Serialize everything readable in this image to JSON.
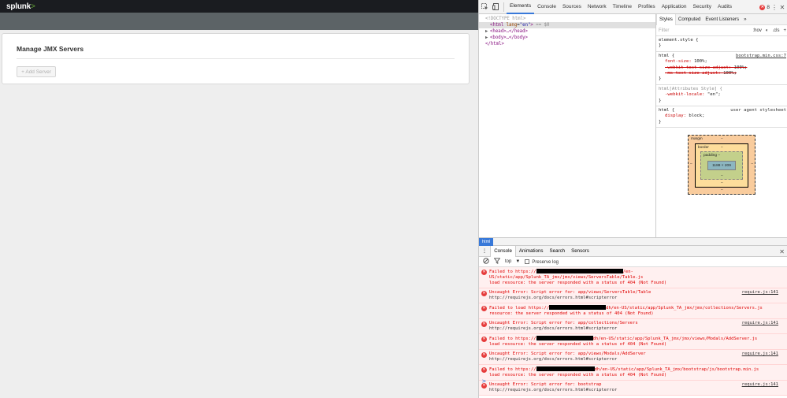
{
  "app": {
    "logo_text": "splunk",
    "logo_suffix": ">",
    "card_title": "Manage JMX Servers",
    "add_server_label": "+ Add Server"
  },
  "devtools": {
    "tabs": [
      "Elements",
      "Console",
      "Sources",
      "Network",
      "Timeline",
      "Profiles",
      "Application",
      "Security",
      "Audits"
    ],
    "active_tab": "Elements",
    "error_count": "8",
    "elements": {
      "doctype": "<!DOCTYPE html>",
      "html_open_tag": "html",
      "html_attr_name": "lang",
      "html_attr_value": "\"en\"",
      "selected_marker": " == $0",
      "head_line": "<head>…</head>",
      "body_line": "<body>…</body>",
      "html_close": "</html>"
    },
    "styles": {
      "tabs": [
        "Styles",
        "Computed",
        "Event Listeners"
      ],
      "filter_placeholder": "Filter",
      "hov_label": ":hov",
      "cls_label": ".cls",
      "element_style": "element.style {",
      "rule1_selector": "html {",
      "rule1_source": "bootstrap.min.css:7",
      "rule1_props": [
        {
          "name": "font-size",
          "value": "100%;",
          "struck": false
        },
        {
          "name": "-webkit-text-size-adjust",
          "value": "100%;",
          "struck": true
        },
        {
          "name": "-ms-text-size-adjust",
          "value": "100%;",
          "struck": true
        }
      ],
      "rule2_selector": "html[Attributes Style] {",
      "rule2_props": [
        {
          "name": "-webkit-locale",
          "value": "\"en\";"
        }
      ],
      "rule3_selector": "html {",
      "rule3_source": "user agent stylesheet",
      "rule3_props": [
        {
          "name": "display",
          "value": "block;"
        }
      ],
      "close_brace": "}"
    },
    "boxmodel": {
      "margin_label": "margin",
      "border_label": "border",
      "padding_label": "padding –",
      "content_size": "1188 × 209",
      "dash": "–"
    },
    "breadcrumb": "html",
    "drawer_tabs": [
      "Console",
      "Animations",
      "Search",
      "Sensors"
    ],
    "console": {
      "context": "top",
      "preserve_log": "Preserve log",
      "messages": [
        {
          "l1a": "Failed to   https://",
          "l1b": "/en-US/static/app/Splunk_TA_jmx/jmx/views/ServersTable/Table.js",
          "l2": "load resource: the server responded with a status of 404 (Not Found)",
          "l3": "",
          "src": ""
        },
        {
          "l1a": "Uncaught Error: Script error for: app/views/ServersTable/Table",
          "l1b": "",
          "l2": "http://requirejs.org/docs/errors.html#scripterror",
          "l3": "",
          "src": "require.js:141"
        },
        {
          "l1a": "Failed to load   https://",
          "l1b": "dh/en-US/static/app/Splunk_TA_jmx/jmx/collections/Servers.js",
          "l2": "resource: the server responded with a status of 404 (Not Found)",
          "l3": "",
          "src": ""
        },
        {
          "l1a": "Uncaught Error: Script error for: app/collections/Servers",
          "l1b": "",
          "l2": "http://requirejs.org/docs/errors.html#scripterror",
          "l3": "",
          "src": "require.js:141"
        },
        {
          "l1a": "Failed to    https://",
          "l1b": "dh/en-US/static/app/Splunk_TA_jmx/jmx/views/Modals/AddServer.js",
          "l2": "load resource: the server responded with a status of 404 (Not Found)",
          "l3": "",
          "src": ""
        },
        {
          "l1a": "Uncaught Error: Script error for: app/views/Modals/AddServer",
          "l1b": "",
          "l2": "http://requirejs.org/docs/errors.html#scripterror",
          "l3": "",
          "src": "require.js:141"
        },
        {
          "l1a": "Failed to   https://",
          "l1b": "dh/en-US/static/app/Splunk_TA_jmx/bootstrap/js/bootstrap.min.js",
          "l2": "load resource: the server responded with a status of 404 (Not Found)",
          "l3": "",
          "src": ""
        },
        {
          "l1a": "Uncaught Error: Script error for: bootstrap",
          "l1b": "",
          "l2": "http://requirejs.org/docs/errors.html#scripterror",
          "l3": "",
          "src": "require.js:141"
        }
      ],
      "prompt": ">"
    },
    "icons": {
      "inspect": "inspect-icon",
      "device": "device-toggle-icon",
      "more": "more-icon",
      "close": "close-icon"
    }
  }
}
